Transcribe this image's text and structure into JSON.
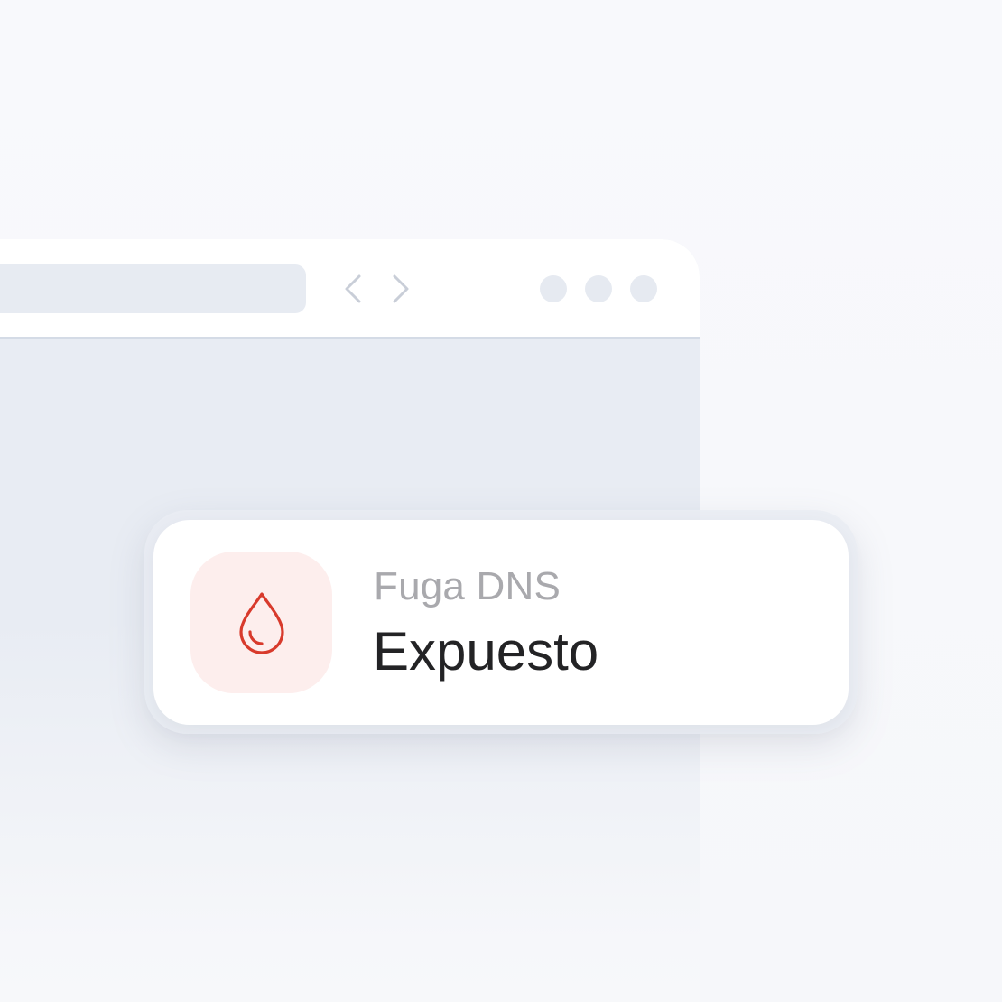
{
  "browser": {
    "nav": {
      "back_icon": "chevron-left-icon",
      "forward_icon": "chevron-right-icon"
    },
    "window_controls_icon": "dot-icon"
  },
  "notification": {
    "icon": "water-drop-icon",
    "label": "Fuga DNS",
    "status": "Expuesto"
  },
  "colors": {
    "accent": "#d83a2c",
    "icon_background": "#fdeeed",
    "label": "#a9a9ad",
    "status": "#232325"
  }
}
